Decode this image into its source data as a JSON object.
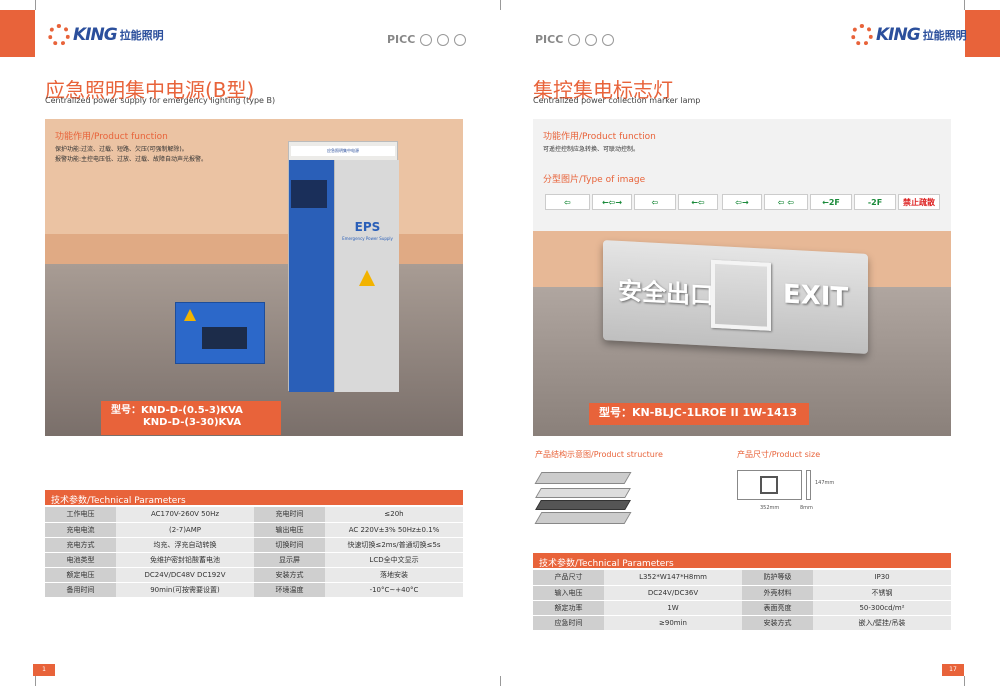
{
  "left": {
    "brand": {
      "name": "KING",
      "cn": "拉能照明"
    },
    "certs": [
      "PICC"
    ],
    "title_cn": "应急照明集中电源(B型)",
    "title_en": "Centralized power supply for emergency lighting (type B)",
    "function": {
      "title": "功能作用/Product function",
      "lines": [
        "保护功能:过流、过载、短路、欠压(可强制解除)。",
        "报警功能:主控电压低、过放、过载、故障自动声光报警。"
      ]
    },
    "cabinet": {
      "label": "EPS",
      "sub": "Emergency Power Supply",
      "top_text": "应急照明集中电源"
    },
    "model": {
      "line1": "型号：KND-D-(0.5-3)KVA",
      "line2": "KND-D-(3-30)KVA"
    },
    "table_title": "技术参数/Technical Parameters",
    "table": [
      [
        "工作电压",
        "AC170V-260V 50Hz",
        "充电时间",
        "≤20h"
      ],
      [
        "充电电流",
        "(2-7)AMP",
        "输出电压",
        "AC 220V±3% 50Hz±0.1%"
      ],
      [
        "充电方式",
        "均充、浮充自动转换",
        "切换时间",
        "快速切换≤2ms/普通切换≤5s"
      ],
      [
        "电池类型",
        "免维护密封铅酸蓄电池",
        "显示屏",
        "LCD全中文显示"
      ],
      [
        "额定电压",
        "DC24V/DC48V DC192V",
        "安装方式",
        "落地安装"
      ],
      [
        "备用时间",
        "90min(可按需要设置)",
        "环境温度",
        "-10°C~+40°C"
      ]
    ],
    "page": "1"
  },
  "right": {
    "brand": {
      "name": "KING",
      "cn": "拉能照明"
    },
    "certs": [
      "PICC"
    ],
    "title_cn": "集控集电标志灯",
    "title_en": "Centralized power collection marker lamp",
    "function": {
      "title": "功能作用/Product function",
      "lines": [
        "可遥控控制应急转换、可联动控制。"
      ]
    },
    "types_title": "分型图片/Type of image",
    "signs": [
      "⇦",
      "←⇦→",
      "⇦",
      "←⇦",
      "⇦→",
      "⇦ ⇦",
      "←2F",
      "-2F",
      "禁止疏散"
    ],
    "panel": {
      "cn": "安全出口",
      "en": "EXIT"
    },
    "model": "型号：KN-BLJC-1LROE II 1W-1413",
    "structure_title": "产品结构示意图/Product structure",
    "size_title": "产品尺寸/Product size",
    "size_labels": {
      "w": "352mm",
      "d": "8mm",
      "h": "147mm"
    },
    "table_title": "技术参数/Technical Parameters",
    "table": [
      [
        "产品尺寸",
        "L352*W147*H8mm",
        "防护等级",
        "IP30"
      ],
      [
        "输入电压",
        "DC24V/DC36V",
        "外壳材料",
        "不锈钢"
      ],
      [
        "额定功率",
        "1W",
        "表面亮度",
        "50-300cd/m²"
      ],
      [
        "应急时间",
        "≥90min",
        "安装方式",
        "嵌入/壁挂/吊装"
      ]
    ],
    "page": "17"
  },
  "colors": {
    "accent": "#e8633a",
    "brand_blue": "#2b4f9c"
  }
}
